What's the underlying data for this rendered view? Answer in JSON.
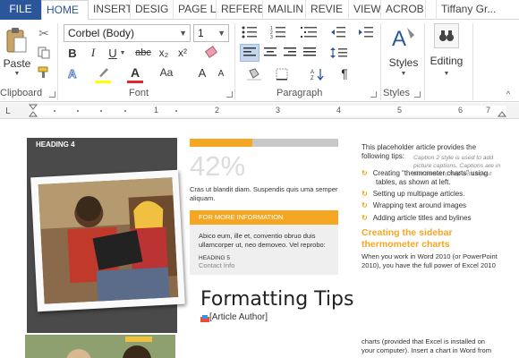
{
  "tabs": {
    "file": "FILE",
    "items": [
      "HOME",
      "INSERT",
      "DESIG",
      "PAGE L",
      "REFERE",
      "MAILIN",
      "REVIE",
      "VIEW",
      "ACROB"
    ],
    "user": "Tiffany Gr..."
  },
  "ribbon": {
    "clipboard": {
      "paste": "Paste",
      "label": "Clipboard"
    },
    "font": {
      "family": "Corbel (Body)",
      "size": "1",
      "bold": "B",
      "italic": "I",
      "underline": "U",
      "strike": "abc",
      "subscript": "x₂",
      "superscript": "x²",
      "grow": "A",
      "shrink": "A",
      "case": "Aa",
      "label": "Font"
    },
    "paragraph": {
      "label": "Paragraph",
      "pilcrow": "¶"
    },
    "styles": {
      "button": "Styles",
      "label": "Styles"
    },
    "editing": {
      "button": "Editing"
    },
    "colors": {
      "highlight": "#ffff00",
      "font_color": "#e0282e",
      "accent": "#2b579a"
    }
  },
  "ruler": {
    "marks": [
      "1",
      "2",
      "3",
      "4",
      "5",
      "6",
      "7"
    ]
  },
  "document": {
    "heading4": "HEADING 4",
    "progress_fraction": 0.42,
    "percent": "42%",
    "lorem1a": "Cras ut blandit diam. Suspendis quis uma semper",
    "lorem1b": "aliquam.",
    "more_info": "FOR MORE INFORMATION",
    "lorem2a": "Abico eum, ille et, conventio obruo duis",
    "lorem2b": "ullamcorper ut, neo demoveo. Vel reprobo:",
    "heading5": "HEADING 5",
    "contact": "Contact Info",
    "title": "Formatting Tips",
    "author": "[Article Author]",
    "intro_a": "This placeholder article provides the",
    "intro_b": "following tips:",
    "caption": "Caption 2 style is used to add picture captions. Captions are in text boxes to help with layout",
    "bullets": [
      "Creating “thermometer charts” using",
      "tables, as shown at left.",
      "Setting up multipage articles.",
      "Wrapping text around images",
      "Adding article titles and bylines"
    ],
    "sidebar_head_a": "Creating the sidebar",
    "sidebar_head_b": "thermometer charts",
    "body1a": "When you work in Word 2010 (or PowerPoint",
    "body1b": "2010), you have the full power of Excel 2010",
    "body2a": "charts (provided that Excel is installed on",
    "body2b": "your computer). Insert a chart in Word from"
  }
}
